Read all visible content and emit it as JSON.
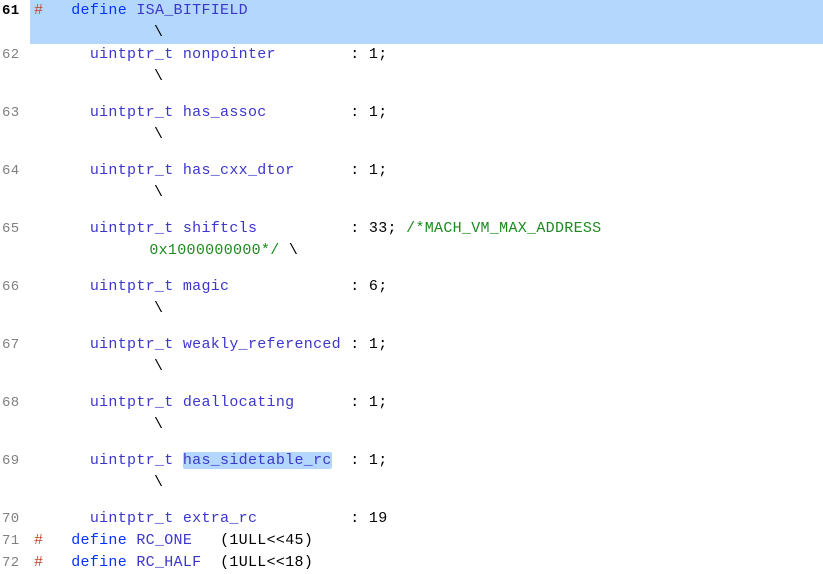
{
  "lines": [
    {
      "n": 61,
      "highlighted": true,
      "main": [
        {
          "cls": "tok-macro",
          "t": "#   "
        },
        {
          "cls": "tok-keyword",
          "t": "define"
        },
        {
          "cls": "",
          "t": " "
        },
        {
          "cls": "tok-define-name",
          "t": "ISA_BITFIELD"
        },
        {
          "cls": "",
          "t": "                                                        "
        }
      ],
      "cont": [
        {
          "cls": "tok-op",
          "t": "\\"
        }
      ]
    },
    {
      "n": 62,
      "main": [
        {
          "cls": "",
          "t": "      "
        },
        {
          "cls": "tok-type",
          "t": "uintptr_t"
        },
        {
          "cls": "",
          "t": " "
        },
        {
          "cls": "tok-ident",
          "t": "nonpointer"
        },
        {
          "cls": "",
          "t": "        "
        },
        {
          "cls": "tok-op",
          "t": ":"
        },
        {
          "cls": "",
          "t": " "
        },
        {
          "cls": "tok-num",
          "t": "1"
        },
        {
          "cls": "tok-punc",
          "t": ";"
        },
        {
          "cls": "",
          "t": "                                       "
        }
      ],
      "cont": [
        {
          "cls": "tok-op",
          "t": "\\"
        }
      ]
    },
    {
      "n": 63,
      "main": [
        {
          "cls": "",
          "t": "      "
        },
        {
          "cls": "tok-type",
          "t": "uintptr_t"
        },
        {
          "cls": "",
          "t": " "
        },
        {
          "cls": "tok-ident",
          "t": "has_assoc"
        },
        {
          "cls": "",
          "t": "         "
        },
        {
          "cls": "tok-op",
          "t": ":"
        },
        {
          "cls": "",
          "t": " "
        },
        {
          "cls": "tok-num",
          "t": "1"
        },
        {
          "cls": "tok-punc",
          "t": ";"
        },
        {
          "cls": "",
          "t": "                                       "
        }
      ],
      "cont": [
        {
          "cls": "tok-op",
          "t": "\\"
        }
      ]
    },
    {
      "n": 64,
      "main": [
        {
          "cls": "",
          "t": "      "
        },
        {
          "cls": "tok-type",
          "t": "uintptr_t"
        },
        {
          "cls": "",
          "t": " "
        },
        {
          "cls": "tok-ident",
          "t": "has_cxx_dtor"
        },
        {
          "cls": "",
          "t": "      "
        },
        {
          "cls": "tok-op",
          "t": ":"
        },
        {
          "cls": "",
          "t": " "
        },
        {
          "cls": "tok-num",
          "t": "1"
        },
        {
          "cls": "tok-punc",
          "t": ";"
        },
        {
          "cls": "",
          "t": "                                       "
        }
      ],
      "cont": [
        {
          "cls": "tok-op",
          "t": "\\"
        }
      ]
    },
    {
      "n": 65,
      "main": [
        {
          "cls": "",
          "t": "      "
        },
        {
          "cls": "tok-type",
          "t": "uintptr_t"
        },
        {
          "cls": "",
          "t": " "
        },
        {
          "cls": "tok-ident",
          "t": "shiftcls"
        },
        {
          "cls": "",
          "t": "          "
        },
        {
          "cls": "tok-op",
          "t": ":"
        },
        {
          "cls": "",
          "t": " "
        },
        {
          "cls": "tok-num",
          "t": "33"
        },
        {
          "cls": "tok-punc",
          "t": ";"
        },
        {
          "cls": "",
          "t": " "
        },
        {
          "cls": "tok-comment",
          "t": "/*MACH_VM_MAX_ADDRESS"
        }
      ],
      "wrap": [
        {
          "cls": "tok-comment",
          "t": " 0x1000000000*/"
        },
        {
          "cls": "",
          "t": " "
        },
        {
          "cls": "tok-op",
          "t": "\\"
        }
      ]
    },
    {
      "n": 66,
      "main": [
        {
          "cls": "",
          "t": "      "
        },
        {
          "cls": "tok-type",
          "t": "uintptr_t"
        },
        {
          "cls": "",
          "t": " "
        },
        {
          "cls": "tok-ident",
          "t": "magic"
        },
        {
          "cls": "",
          "t": "             "
        },
        {
          "cls": "tok-op",
          "t": ":"
        },
        {
          "cls": "",
          "t": " "
        },
        {
          "cls": "tok-num",
          "t": "6"
        },
        {
          "cls": "tok-punc",
          "t": ";"
        },
        {
          "cls": "",
          "t": "                                       "
        }
      ],
      "cont": [
        {
          "cls": "tok-op",
          "t": "\\"
        }
      ]
    },
    {
      "n": 67,
      "main": [
        {
          "cls": "",
          "t": "      "
        },
        {
          "cls": "tok-type",
          "t": "uintptr_t"
        },
        {
          "cls": "",
          "t": " "
        },
        {
          "cls": "tok-ident",
          "t": "weakly_referenced"
        },
        {
          "cls": "",
          "t": " "
        },
        {
          "cls": "tok-op",
          "t": ":"
        },
        {
          "cls": "",
          "t": " "
        },
        {
          "cls": "tok-num",
          "t": "1"
        },
        {
          "cls": "tok-punc",
          "t": ";"
        },
        {
          "cls": "",
          "t": "                                       "
        }
      ],
      "cont": [
        {
          "cls": "tok-op",
          "t": "\\"
        }
      ]
    },
    {
      "n": 68,
      "main": [
        {
          "cls": "",
          "t": "      "
        },
        {
          "cls": "tok-type",
          "t": "uintptr_t"
        },
        {
          "cls": "",
          "t": " "
        },
        {
          "cls": "tok-ident",
          "t": "deallocating"
        },
        {
          "cls": "",
          "t": "      "
        },
        {
          "cls": "tok-op",
          "t": ":"
        },
        {
          "cls": "",
          "t": " "
        },
        {
          "cls": "tok-num",
          "t": "1"
        },
        {
          "cls": "tok-punc",
          "t": ";"
        },
        {
          "cls": "",
          "t": "                                       "
        }
      ],
      "cont": [
        {
          "cls": "tok-op",
          "t": "\\"
        }
      ]
    },
    {
      "n": 69,
      "main": [
        {
          "cls": "",
          "t": "      "
        },
        {
          "cls": "tok-type",
          "t": "uintptr_t"
        },
        {
          "cls": "",
          "t": " "
        },
        {
          "cls": "tok-ident sel",
          "t": "has_sidetable_rc"
        },
        {
          "cls": "",
          "t": "  "
        },
        {
          "cls": "tok-op",
          "t": ":"
        },
        {
          "cls": "",
          "t": " "
        },
        {
          "cls": "tok-num",
          "t": "1"
        },
        {
          "cls": "tok-punc",
          "t": ";"
        },
        {
          "cls": "",
          "t": "                                       "
        }
      ],
      "cont": [
        {
          "cls": "tok-op",
          "t": "\\"
        }
      ]
    },
    {
      "n": 70,
      "main": [
        {
          "cls": "",
          "t": "      "
        },
        {
          "cls": "tok-type",
          "t": "uintptr_t"
        },
        {
          "cls": "",
          "t": " "
        },
        {
          "cls": "tok-ident",
          "t": "extra_rc"
        },
        {
          "cls": "",
          "t": "          "
        },
        {
          "cls": "tok-op",
          "t": ":"
        },
        {
          "cls": "",
          "t": " "
        },
        {
          "cls": "tok-num",
          "t": "19"
        }
      ]
    },
    {
      "n": 71,
      "main": [
        {
          "cls": "tok-macro",
          "t": "#   "
        },
        {
          "cls": "tok-keyword",
          "t": "define"
        },
        {
          "cls": "",
          "t": " "
        },
        {
          "cls": "tok-define-name",
          "t": "RC_ONE"
        },
        {
          "cls": "",
          "t": "   "
        },
        {
          "cls": "tok-punc",
          "t": "("
        },
        {
          "cls": "tok-num",
          "t": "1ULL"
        },
        {
          "cls": "tok-op",
          "t": "<<"
        },
        {
          "cls": "tok-num",
          "t": "45"
        },
        {
          "cls": "tok-punc",
          "t": ")"
        }
      ]
    },
    {
      "n": 72,
      "main": [
        {
          "cls": "tok-macro",
          "t": "#   "
        },
        {
          "cls": "tok-keyword",
          "t": "define"
        },
        {
          "cls": "",
          "t": " "
        },
        {
          "cls": "tok-define-name",
          "t": "RC_HALF"
        },
        {
          "cls": "",
          "t": "  "
        },
        {
          "cls": "tok-punc",
          "t": "("
        },
        {
          "cls": "tok-num",
          "t": "1ULL"
        },
        {
          "cls": "tok-op",
          "t": "<<"
        },
        {
          "cls": "tok-num",
          "t": "18"
        },
        {
          "cls": "tok-punc",
          "t": ")"
        }
      ]
    }
  ]
}
